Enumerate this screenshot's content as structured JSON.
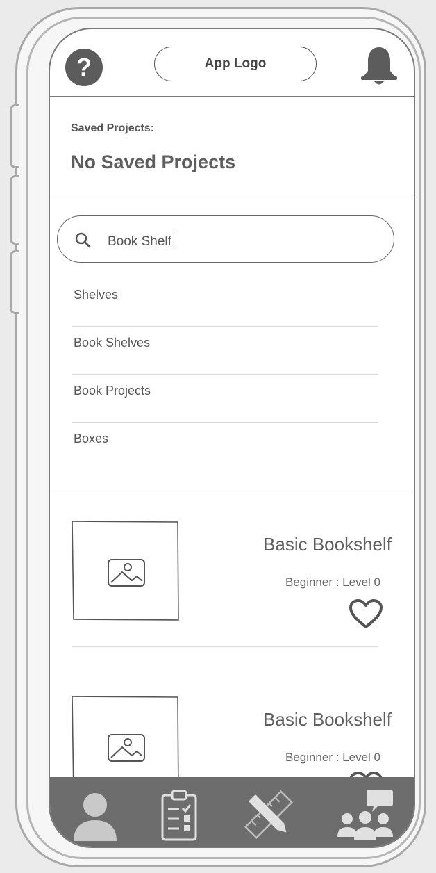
{
  "header": {
    "logo_label": "App Logo",
    "help_icon": "help-icon",
    "bell_icon": "bell-icon"
  },
  "saved": {
    "label": "Saved Projects:",
    "value": "No Saved Projects"
  },
  "search": {
    "value": "Book Shelf",
    "icon": "search-icon"
  },
  "suggestions": [
    "Shelves",
    "Book Shelves",
    "Book Projects",
    "Boxes"
  ],
  "projects": [
    {
      "title": "Basic Bookshelf",
      "level": "Beginner : Level 0"
    },
    {
      "title": "Basic Bookshelf",
      "level": "Beginner : Level 0"
    }
  ],
  "tabbar": {
    "icons": [
      "profile-icon",
      "clipboard-checklist-icon",
      "ruler-pencil-icon",
      "community-icon"
    ]
  },
  "colors": {
    "icon_dark": "#5c5c5c",
    "tabbar": "#6d6d6d",
    "frame": "#a8a8a8"
  }
}
